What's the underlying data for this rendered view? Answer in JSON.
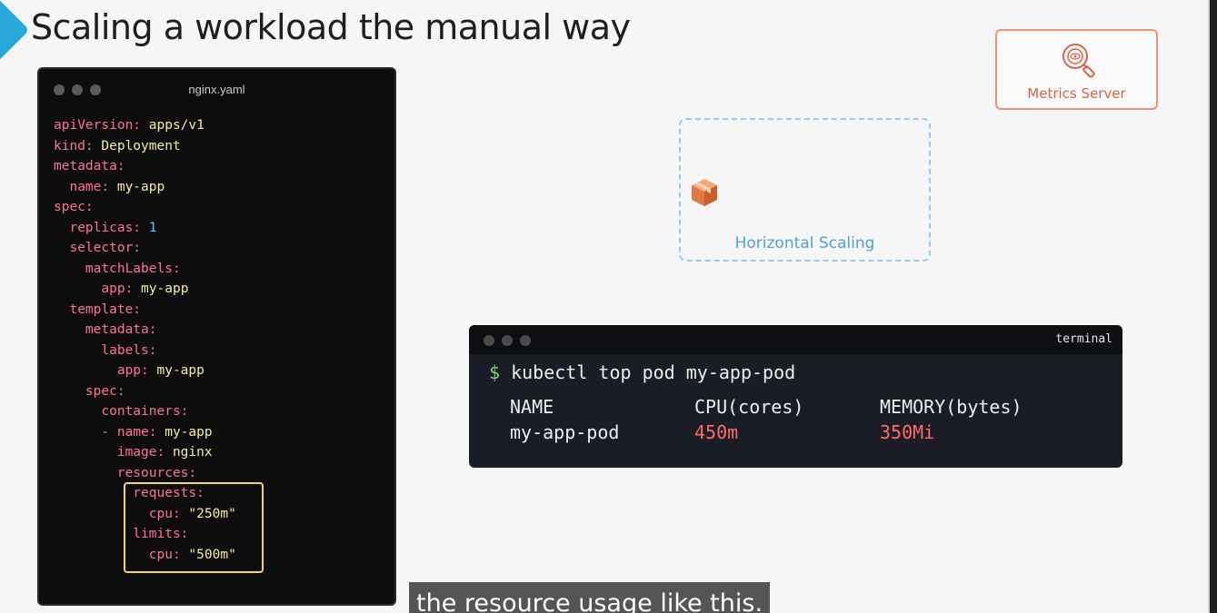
{
  "slide": {
    "title": "Scaling a workload the manual way"
  },
  "editor": {
    "filename": "nginx.yaml",
    "lines": [
      {
        "k": "apiVersion:",
        "v": " apps/v1"
      },
      {
        "k": "kind:",
        "v": " Deployment"
      },
      {
        "k": "metadata:",
        "v": ""
      },
      {
        "k": "  name:",
        "v": " my-app"
      },
      {
        "k": "spec:",
        "v": ""
      },
      {
        "k": "  replicas:",
        "v": " 1"
      },
      {
        "k": "  selector:",
        "v": ""
      },
      {
        "k": "    matchLabels:",
        "v": ""
      },
      {
        "k": "      app:",
        "v": " my-app"
      },
      {
        "k": "  template:",
        "v": ""
      },
      {
        "k": "    metadata:",
        "v": ""
      },
      {
        "k": "      labels:",
        "v": ""
      },
      {
        "k": "        app:",
        "v": " my-app"
      },
      {
        "k": "    spec:",
        "v": ""
      },
      {
        "k": "      containers:",
        "v": ""
      },
      {
        "k": "      - name:",
        "v": " my-app"
      },
      {
        "k": "        image:",
        "v": " nginx"
      },
      {
        "k": "        resources:",
        "v": ""
      },
      {
        "k": "          requests:",
        "v": ""
      },
      {
        "k": "            cpu:",
        "v": " \"250m\""
      },
      {
        "k": "          limits:",
        "v": ""
      },
      {
        "k": "            cpu:",
        "v": " \"500m\""
      }
    ]
  },
  "metrics_server": {
    "label": "Metrics Server"
  },
  "horizontal_scaling": {
    "label": "Horizontal Scaling"
  },
  "terminal": {
    "title": "terminal",
    "prompt": "$",
    "command": "kubectl top pod my-app-pod",
    "headers": [
      "NAME",
      "CPU(cores)",
      "MEMORY(bytes)"
    ],
    "row": [
      "my-app-pod",
      "450m",
      "350Mi"
    ]
  },
  "caption": {
    "text": "the resource usage like this."
  },
  "colors": {
    "yaml_key": "#ff6fa0",
    "yaml_value": "#f5ee9e",
    "yaml_number": "#5fc7ff",
    "metrics_accent": "#d7654a",
    "scaling_accent": "#4da3d8",
    "usage_value": "#ff6b6b"
  }
}
